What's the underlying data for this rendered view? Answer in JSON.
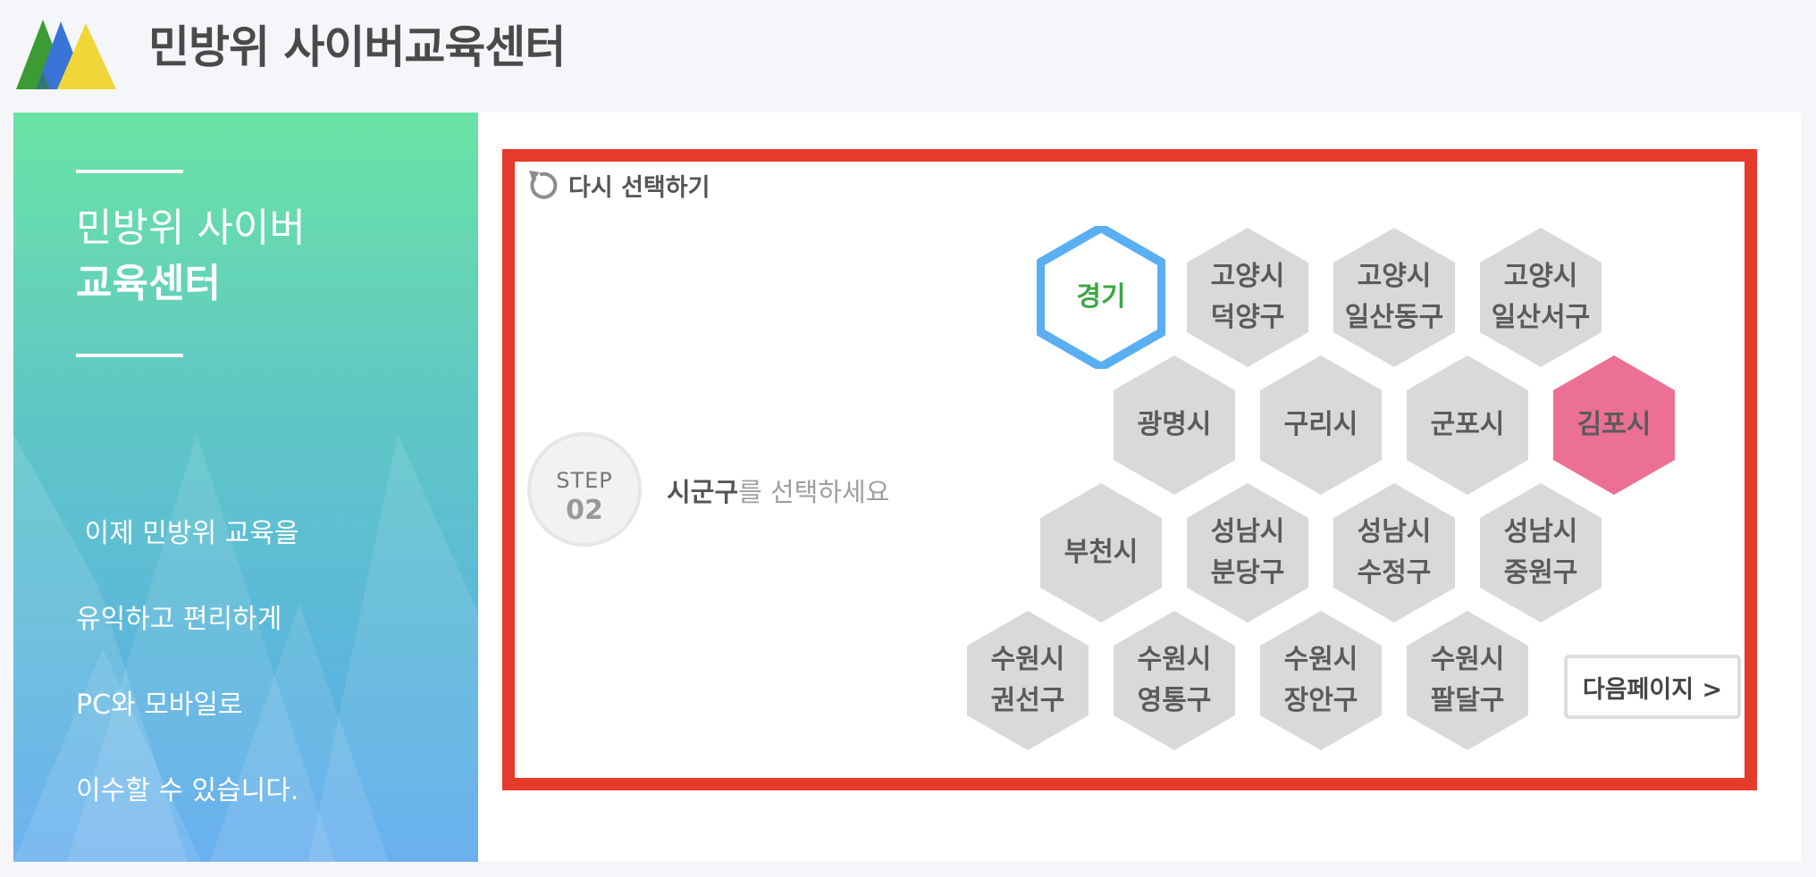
{
  "header": {
    "title": "민방위 사이버교육센터"
  },
  "sidebar": {
    "title_line1": "민방위 사이버",
    "title_line2": "교육센터",
    "description": [
      " 이제 민방위 교육을",
      "유익하고 편리하게",
      "PC와 모바일로",
      "이수할 수 있습니다."
    ]
  },
  "selector": {
    "reset_label": "다시 선택하기",
    "step_word": "STEP",
    "step_number": "02",
    "instruction_strong": "시군구",
    "instruction_rest": "를 선택하세요",
    "next_label": "다음페이지 >",
    "selected_province": {
      "lines": [
        "경기"
      ],
      "text_color": "#3aa845",
      "border_color": "#5aaef2"
    },
    "highlighted_color": "#ec6f95",
    "default_color": "#d9d9d9",
    "districts": [
      {
        "id": "goyang-deogyang",
        "lines": [
          "고양시",
          "덕양구"
        ]
      },
      {
        "id": "goyang-ilsandong",
        "lines": [
          "고양시",
          "일산동구"
        ]
      },
      {
        "id": "goyang-ilsanseo",
        "lines": [
          "고양시",
          "일산서구"
        ]
      },
      {
        "id": "gwangmyeong",
        "lines": [
          "광명시"
        ]
      },
      {
        "id": "guri",
        "lines": [
          "구리시"
        ]
      },
      {
        "id": "gunpo",
        "lines": [
          "군포시"
        ]
      },
      {
        "id": "gimpo",
        "lines": [
          "김포시"
        ],
        "highlighted": true
      },
      {
        "id": "bucheon",
        "lines": [
          "부천시"
        ]
      },
      {
        "id": "seongnam-bundang",
        "lines": [
          "성남시",
          "분당구"
        ]
      },
      {
        "id": "seongnam-sujeong",
        "lines": [
          "성남시",
          "수정구"
        ]
      },
      {
        "id": "seongnam-jungwon",
        "lines": [
          "성남시",
          "중원구"
        ]
      },
      {
        "id": "suwon-gwonseon",
        "lines": [
          "수원시",
          "권선구"
        ]
      },
      {
        "id": "suwon-yeongtong",
        "lines": [
          "수원시",
          "영통구"
        ]
      },
      {
        "id": "suwon-jangan",
        "lines": [
          "수원시",
          "장안구"
        ]
      },
      {
        "id": "suwon-paldal",
        "lines": [
          "수원시",
          "팔달구"
        ]
      }
    ]
  }
}
